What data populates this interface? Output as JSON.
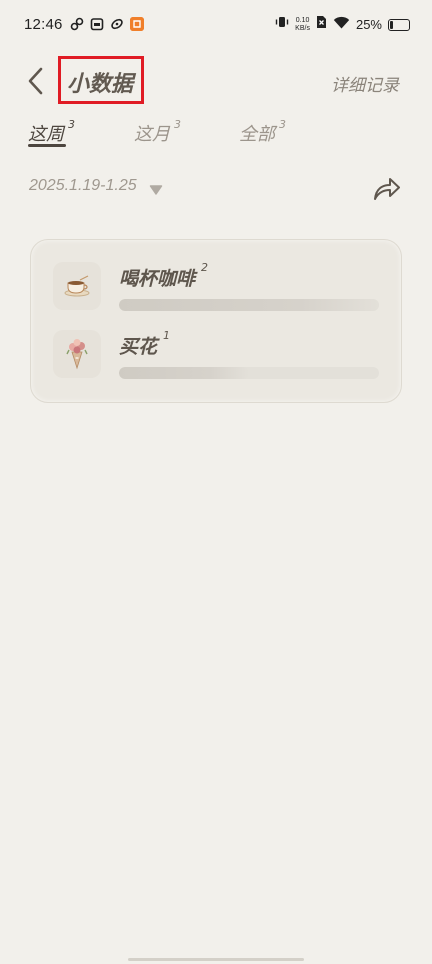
{
  "status_bar": {
    "time": "12:46",
    "net_speed_value": "0.10",
    "net_speed_unit": "KB/s",
    "battery_pct": "25%",
    "battery_level": 0.25
  },
  "header": {
    "title": "小数据",
    "detail_link": "详细记录"
  },
  "tabs": [
    {
      "label": "这周",
      "count": "3",
      "active": true
    },
    {
      "label": "这月",
      "count": "3",
      "active": false
    },
    {
      "label": "全部",
      "count": "3",
      "active": false
    }
  ],
  "date_range": "2025.1.19-1.25",
  "items": [
    {
      "label": "喝杯咖啡",
      "count": "2",
      "icon": "coffee-cup-icon",
      "fill": 1.0
    },
    {
      "label": "买花",
      "count": "1",
      "icon": "flower-bouquet-icon",
      "fill": 0.5
    }
  ],
  "colors": {
    "background": "#f2f0eb",
    "title_highlight_border": "#e01b24",
    "text_primary": "#5e564d",
    "text_muted": "#9c958c"
  }
}
